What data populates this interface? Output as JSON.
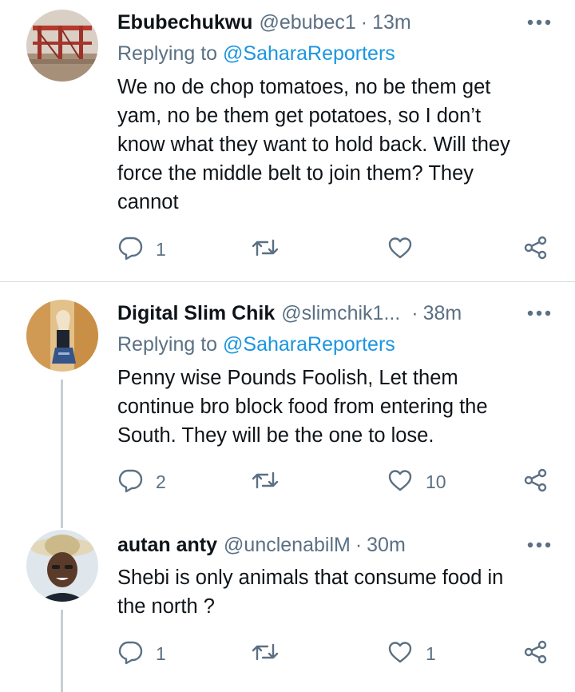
{
  "tweets": [
    {
      "name": "Ebubechukwu",
      "handle": "@ebubec1",
      "time": "13m",
      "replying_label": "Replying to",
      "replying_mention": "@SaharaReporters",
      "body_lines": [
        "We no de chop tomatoes, no be them get",
        "yam, no be them get potatoes, so I don’t",
        "know what they want to hold back. Will they",
        "force the middle belt to join them? They",
        "cannot"
      ],
      "replies": "1",
      "retweets": "",
      "likes": ""
    },
    {
      "name": "Digital Slim Chik",
      "handle": "@slimchik1...",
      "time": "38m",
      "replying_label": "Replying to",
      "replying_mention": "@SaharaReporters",
      "body_lines": [
        "Penny wise Pounds Foolish, Let them",
        "continue bro block food from entering the",
        "South. They will be the one to lose."
      ],
      "replies": "2",
      "retweets": "",
      "likes": "10"
    },
    {
      "name": "autan anty",
      "handle": "@unclenabilM",
      "time": "30m",
      "body_lines": [
        "Shebi is only animals that consume food in",
        "the north ?"
      ],
      "replies": "1",
      "retweets": "",
      "likes": "1"
    }
  ],
  "separator": "·",
  "icons": {
    "more": "more-dots-icon",
    "reply": "reply-bubble-icon",
    "retweet": "retweet-icon",
    "like": "heart-icon",
    "share": "share-icon"
  },
  "colors": {
    "mention": "#1b95e0",
    "secondary_text": "#5b7083",
    "icon": "#5b7083",
    "thread_line": "#c4cfd6"
  }
}
